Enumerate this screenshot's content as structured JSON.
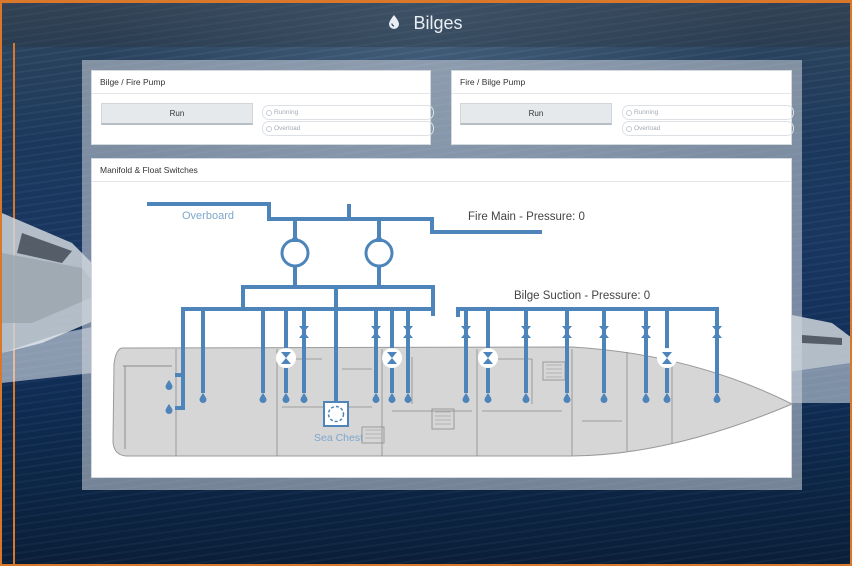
{
  "header": {
    "title": "Bilges",
    "icon": "drop-icon"
  },
  "colors": {
    "accent": "#d9782b",
    "pipe": "#4d85bb",
    "hull": "#d6d6d6"
  },
  "pump_left": {
    "title": "Bilge / Fire Pump",
    "run_label": "Run",
    "status": [
      "Running",
      "Overload"
    ]
  },
  "pump_right": {
    "title": "Fire / Bilge Pump",
    "run_label": "Run",
    "status": [
      "Running",
      "Overload"
    ]
  },
  "manifold": {
    "title": "Manifold & Float Switches",
    "overboard_label": "Overboard",
    "fire_main_label": "Fire Main - Pressure: 0",
    "bilge_suction_label": "Bilge Suction - Pressure: 0",
    "sea_chest_label": "Sea Chest"
  }
}
